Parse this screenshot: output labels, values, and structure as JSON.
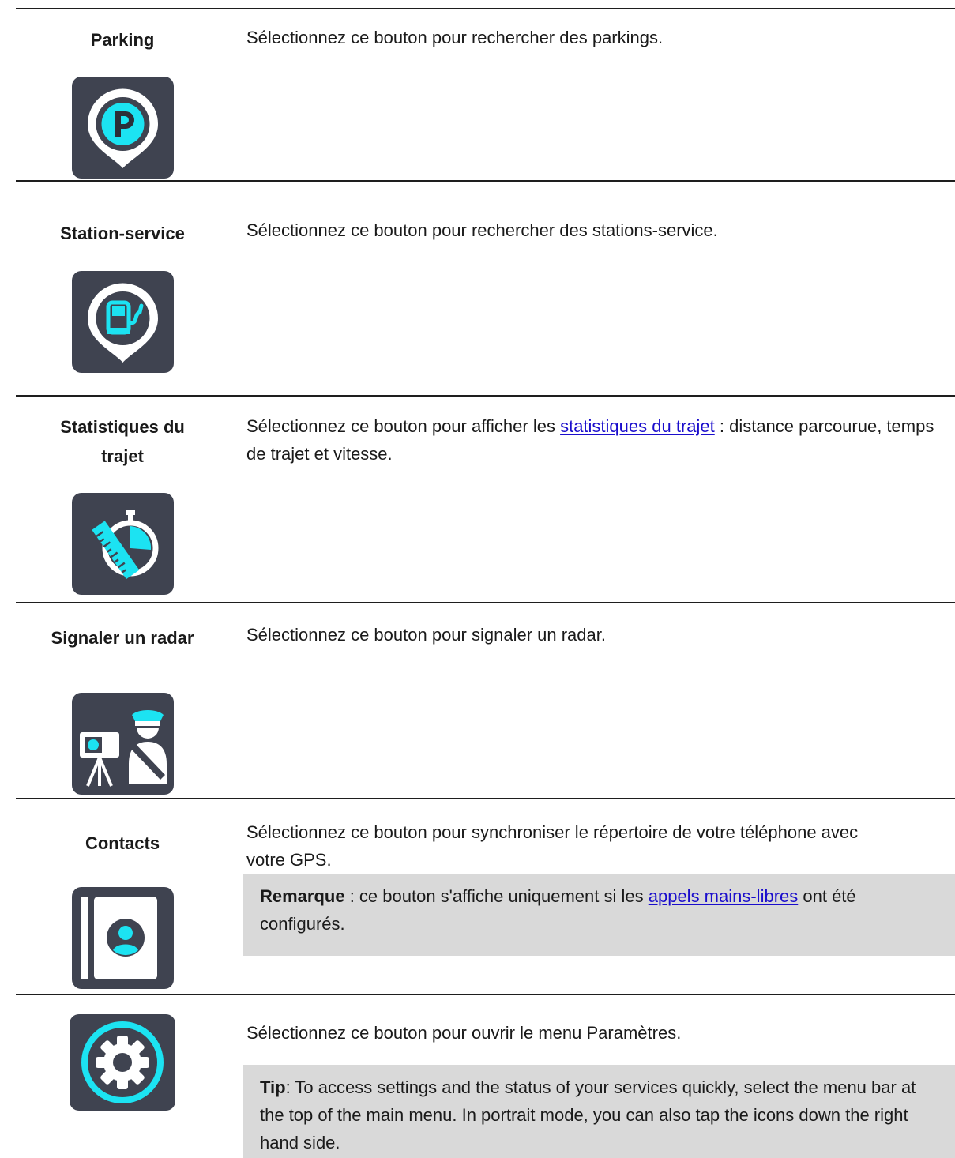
{
  "rows": [
    {
      "label": "Parking",
      "icon": "parking-pin-icon",
      "desc": "Sélectionnez ce bouton pour rechercher des parkings."
    },
    {
      "label": "Station-service",
      "icon": "fuel-station-pin-icon",
      "desc": "Sélectionnez ce bouton pour rechercher des stations-service."
    },
    {
      "label_line1": "Statistiques du",
      "label_line2": "trajet",
      "icon": "trip-stats-stopwatch-ruler-icon",
      "desc_before": "Sélectionnez ce bouton pour afficher les ",
      "desc_link": "statistiques du trajet",
      "desc_after": "  : distance parcourue, temps de trajet et vitesse."
    },
    {
      "label": "Signaler un radar",
      "icon": "speed-camera-officer-icon",
      "desc": "Sélectionnez ce bouton pour signaler un radar."
    },
    {
      "label": "Contacts",
      "icon": "contacts-book-icon",
      "desc": "Sélectionnez ce bouton pour synchroniser le répertoire de votre téléphone avec votre GPS.",
      "note_bold": "Remarque",
      "note_before": "  : ce bouton s'affiche uniquement si les ",
      "note_link": "appels mains-libres",
      "note_after": " ont été configurés."
    },
    {
      "label": "",
      "icon": "settings-gear-icon",
      "desc": "Sélectionnez ce bouton pour ouvrir le menu Paramètres.",
      "note_bold": "Tip",
      "note_after": ": To access settings and the status of your services quickly, select the menu bar at the top of the main menu. In portrait mode, you can also tap the icons down the right hand side."
    }
  ],
  "colors": {
    "icon_bg": "#3f4350",
    "accent": "#1ce3f2",
    "link": "#1a0dcc",
    "note_bg": "#d9d9d9",
    "rule": "#1e1e1e"
  }
}
